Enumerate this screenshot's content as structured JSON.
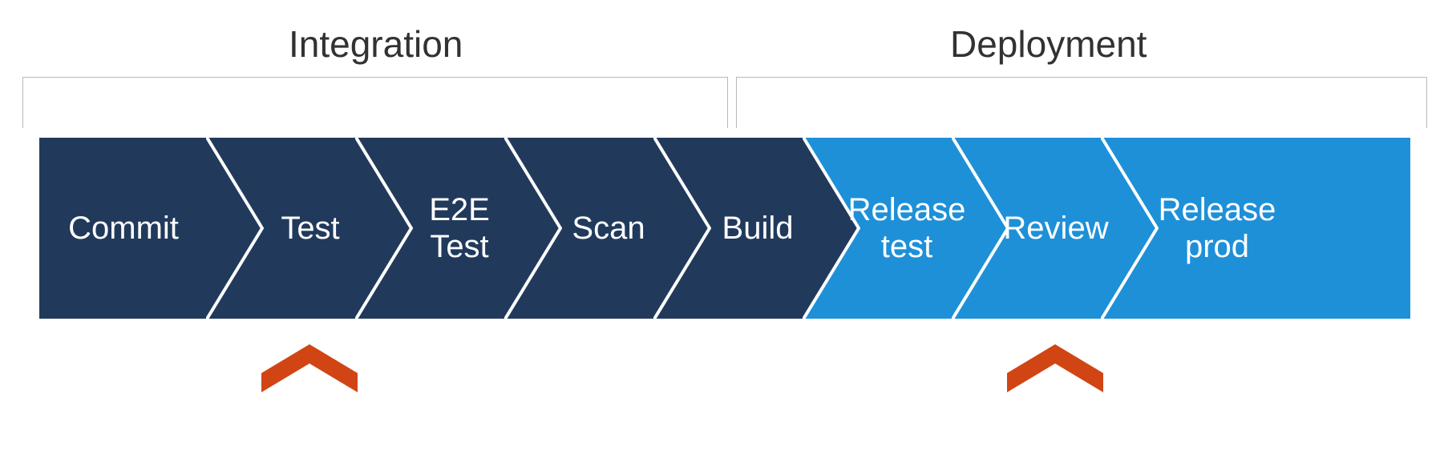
{
  "phases": {
    "integration": {
      "title": "Integration"
    },
    "deployment": {
      "title": "Deployment"
    }
  },
  "colors": {
    "dark": "#213a5c",
    "light": "#1e90d8",
    "stroke": "#ffffff",
    "caret": "#d14514",
    "bracket": "#b8b8b8"
  },
  "stages": [
    {
      "id": "commit",
      "label": "Commit",
      "phase": "integration"
    },
    {
      "id": "test",
      "label": "Test",
      "phase": "integration"
    },
    {
      "id": "e2e-test",
      "label": "E2E\nTest",
      "phase": "integration"
    },
    {
      "id": "scan",
      "label": "Scan",
      "phase": "integration"
    },
    {
      "id": "build",
      "label": "Build",
      "phase": "integration"
    },
    {
      "id": "release-test",
      "label": "Release\ntest",
      "phase": "deployment"
    },
    {
      "id": "review",
      "label": "Review",
      "phase": "deployment"
    },
    {
      "id": "release-prod",
      "label": "Release\nprod",
      "phase": "deployment"
    }
  ],
  "carets_under": [
    "test",
    "review"
  ]
}
